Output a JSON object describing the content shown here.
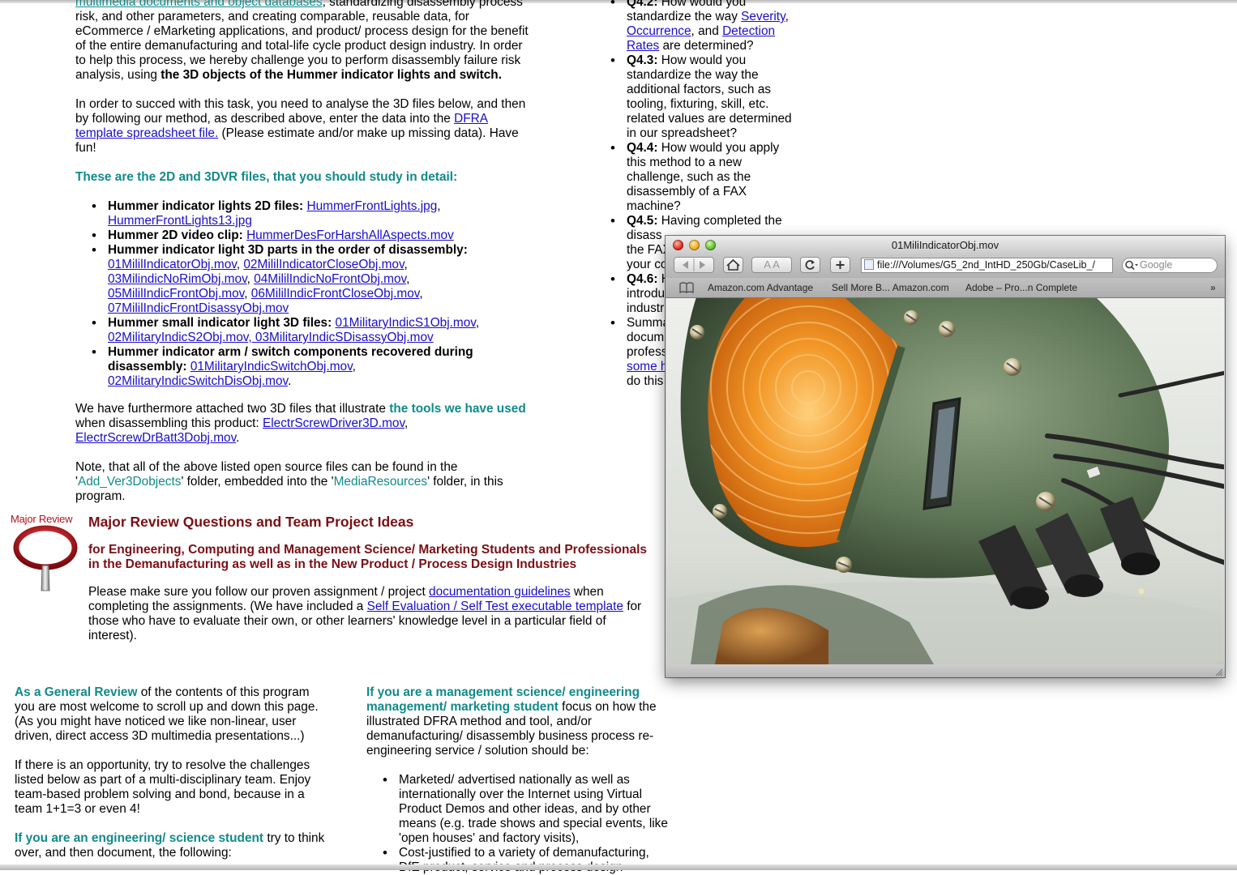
{
  "left_col": {
    "intro_lines": {
      "t0": "multimedia documents and object databases",
      "t1": ", standardizing disassembly process risk, and other parameters, and creating comparable, reusable data, for eCommerce / eMarketing applications, and product/ process design for the benefit of the entire demanufacturing and total-life cycle product design industry. In order to help this process, we hereby challenge you to perform disassembly failure risk analysis, using ",
      "t2": "the 3D objects of the Hummer indicator lights and switch."
    },
    "task": {
      "t1": "In order to succed with this task, you need to analyse the 3D files below, and then by following our method, as described above, enter the data into the ",
      "link": "DFRA template spreadsheet file.",
      "t2": " (Please estimate and/or make up missing data). Have fun!"
    },
    "files_heading": "These are the 2D and 3DVR files, that you should study in detail:",
    "files": {
      "i1_label": "Hummer indicator lights 2D files: ",
      "i1_l1": "HummerFrontLights.jpg",
      "i1_l2": "HummerFrontLights13.jpg",
      "i2_label": "Hummer 2D video clip: ",
      "i2_l1": "HummerDesForHarshAllAspects.mov",
      "i3_label": "Hummer indicator light 3D parts in the order of disassembly:",
      "i3_l1": "01MililIndicatorObj.mov",
      "i3_l2": "02MililIndicatorCloseObj.mov",
      "i3_l3": "03MilindicNoRimObj.mov",
      "i3_l4": "04MililIndicNoFrontObj.mov",
      "i3_l5": "05MililIndicFrontObj.mov",
      "i3_l6": "06MililIndicFrontCloseObj.mov",
      "i3_l7": "07MililIndicFrontDisassyObj.mov",
      "i4_label": "Hummer small indicator light 3D files: ",
      "i4_l1": "01MilitaryIndicS1Obj.mov",
      "i4_l2": "02MilitaryIndicS2Obj.mov, 03MilitaryIndicSDisassyObj.mov",
      "i5_label": "Hummer indicator arm / switch components recovered during disassembly: ",
      "i5_l1": "01MilitaryIndicSwitchObj.mov",
      "i5_l2": "02MilitaryIndicSwitchDisObj.mov"
    },
    "tools": {
      "t1": "We have furthermore attached two 3D files that illustrate ",
      "em": "the tools we have used",
      "t2": " when disassembling this product: ",
      "l1": "ElectrScrewDriver3D.mov",
      "l2": "ElectrScrewDrBatt3Dobj.mov"
    },
    "note": {
      "t1": "Note, that all of the above listed open source files can be found in the '",
      "f1": "Add_Ver3Dobjects",
      "t2": "' folder, embedded into the '",
      "f2": "MediaResources",
      "t3": "' folder, in this program."
    }
  },
  "right_col": {
    "q42_label": "Q4.2:",
    "q42_t1": " How would you standardize the way ",
    "q42_l1": "Severity",
    "q42_l2": "Occurrence",
    "q42_t2": ", and ",
    "q42_l3": "Detection Rates",
    "q42_t3": " are determined?",
    "q43_label": "Q4.3:",
    "q43_t": " How would you standardize the way the additional factors, such as tooling, fixturing, skill, etc. related values are determined in our spreadsheet?",
    "q44_label": "Q4.4:",
    "q44_t": " How would you apply this method to a new challenge, such as the disassembly of a FAX machine?",
    "q45_label": "Q4.5:",
    "q45_t": " Having completed the disass",
    "q45_t2": "the FAX",
    "q45_t3": "your co",
    "q46_label": "Q4.6:",
    "q46_t1": " H",
    "q46_t2": "introdu",
    "q46_t3": "industr",
    "sum_t1": "Summa",
    "sum_t2": "docum",
    "sum_t3": "profess",
    "sum_l1": "some h",
    "sum_t4": "do this"
  },
  "review": {
    "icon_label": "Major Review",
    "heading": "Major Review Questions and Team Project Ideas",
    "subheading": "for Engineering, Computing and Management Science/ Marketing Students and Professionals in the Demanufacturing as well as in the New Product / Process Design Industries",
    "p_t1": "Please make sure you follow our proven assignment / project ",
    "p_l1": "documentation guidelines",
    "p_t2": " when completing the assignments. (We have included a ",
    "p_l2": "Self Evaluation / Self Test executable template",
    "p_t3": " for those who have to evaluate their own, or other learners' knowledge level in a particular field of interest)."
  },
  "general_col": {
    "em1": "As a General Review",
    "t1": " of the contents of this program you are most welcome to scroll up and down this page. (As you might have noticed we like non-linear, user driven, direct access 3D multimedia presentations...)",
    "p2": "If there is an opportunity, try to resolve the challenges listed below as part of a multi-disciplinary team. Enjoy team-based problem solving and bond, because in a team 1+1=3 or even 4!",
    "em2": "If you are an engineering/ science student",
    "t2": " try to think over, and then document, the following:"
  },
  "mgmt_col": {
    "em": "If you are a management science/ engineering management/ marketing student",
    "t1": " focus on how the illustrated DFRA method and tool, and/or demanufacturing/ disassembly business process re-engineering service / solution should be:",
    "b1": "Marketed/ advertised nationally as well as internationally over the Internet using Virtual Product Demos and other ideas, and by other means (e.g. trade shows and special events, like 'open houses' and factory visits),",
    "b2": "Cost-justified to a variety of demanufacturing, DfE product, service and process design"
  },
  "browser": {
    "title": "01MiliIndicatorObj.mov",
    "url": "file:///Volumes/G5_2nd_IntHD_250Gb/CaseLib_/",
    "search_placeholder": "Google",
    "bookmarks": [
      "Amazon.com Advantage",
      "Sell More B... Amazon.com",
      "Adobe – Pro...n Complete"
    ],
    "text_size_label": "A A"
  },
  "colors": {
    "link": "#1a0dcc",
    "teal": "#118a8a",
    "maroon": "#7a0f14",
    "lens_amber": "#e07812",
    "housing_green": "#5f7656"
  }
}
